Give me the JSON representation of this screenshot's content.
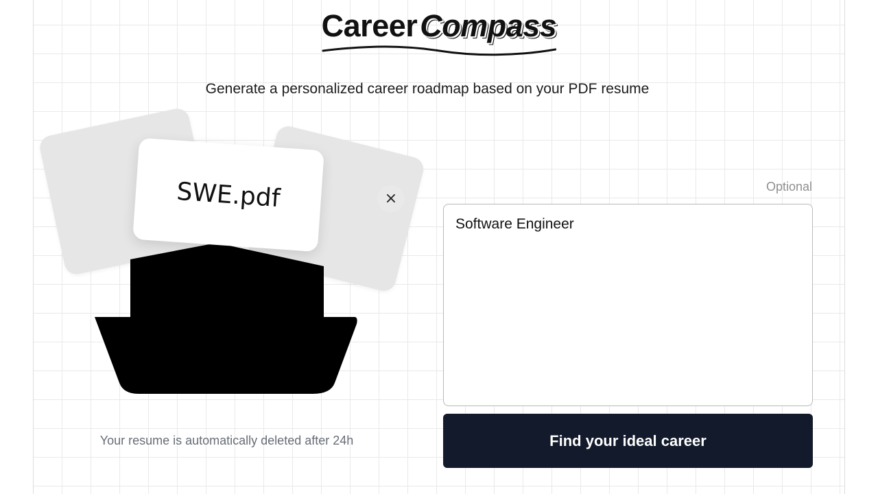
{
  "brand": {
    "name_part1": "Career",
    "name_part2": "Compass"
  },
  "tagline": "Generate a personalized career roadmap based on your PDF resume",
  "upload": {
    "file_name": "SWE.pdf",
    "remove_icon": "close-icon",
    "remove_glyph": "×",
    "notice": "Your resume is automatically deleted after 24h"
  },
  "career_form": {
    "optional_label": "Optional",
    "value": "Software Engineer",
    "submit_label": "Find your ideal career"
  },
  "colors": {
    "primary_button": "#121a2b",
    "grid_line": "#e9e9e9",
    "card_back": "#e6e6e6"
  }
}
